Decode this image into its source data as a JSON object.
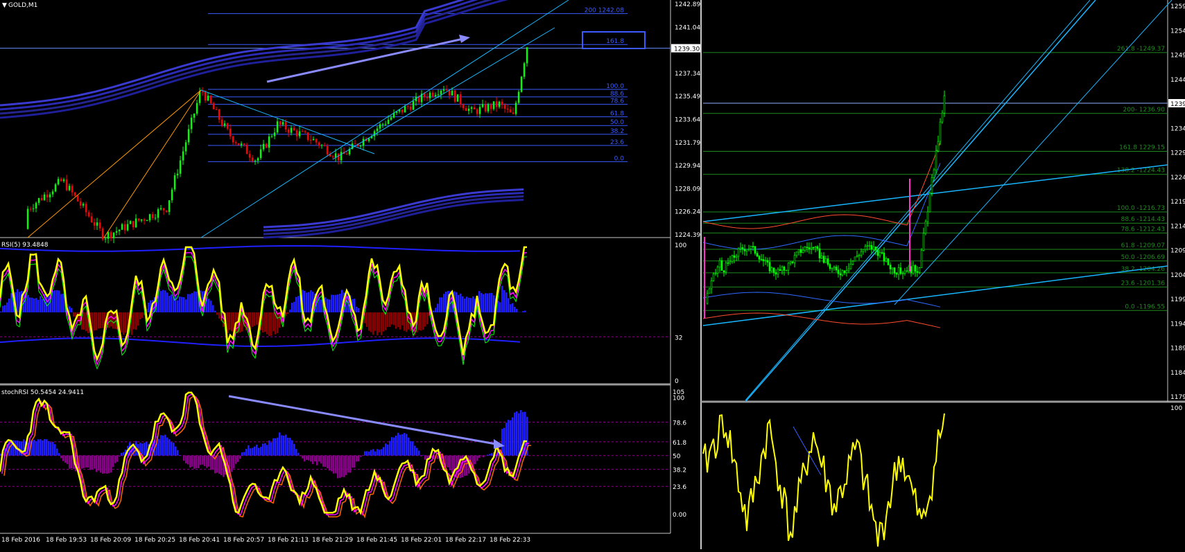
{
  "colors": {
    "background": "#000000",
    "bull_candle": "#00ff00",
    "bear_candle": "#ff0000",
    "fib_blue": "#3b5bff",
    "fib_green": "#1f8a1f",
    "rsi_yellow": "#ffff00",
    "hist_blue": "#1f1fff",
    "hist_red": "#8b0000",
    "hist_purple": "#8b008b",
    "trend_cyan": "#17b6ff",
    "arrow_violet": "#8a8aff",
    "divider": "#808080"
  },
  "left": {
    "main": {
      "title": "GOLD,M1",
      "price_current": "1239.30",
      "price_ticks": [
        "1242.89",
        "1241.04",
        "1237.34",
        "1235.49",
        "1233.64",
        "1231.79",
        "1229.94",
        "1228.09",
        "1226.24",
        "1224.39"
      ],
      "fib_labels": [
        "200 1242.08",
        "161.8",
        "100.0",
        "88.6",
        "78.6",
        "61.8",
        "50.0",
        "38.2",
        "23.6",
        "0.0"
      ]
    },
    "rsi": {
      "title": "RSI(5) 93.4848",
      "ticks": [
        "100",
        "32",
        "0"
      ]
    },
    "stoch": {
      "title": "stochRSI 50.5454 24.9411",
      "ticks": [
        "105",
        "100",
        "78.6",
        "61.8",
        "50",
        "38.2",
        "23.6",
        "0.00"
      ]
    },
    "time_labels": [
      "18 Feb 2016",
      "18 Feb 19:53",
      "18 Feb 20:09",
      "18 Feb 20:25",
      "18 Feb 20:41",
      "18 Feb 20:57",
      "18 Feb 21:13",
      "18 Feb 21:29",
      "18 Feb 21:45",
      "18 Feb 22:01",
      "18 Feb 22:17",
      "18 Feb 22:33"
    ]
  },
  "right": {
    "price_ticks": [
      "1259",
      "1254",
      "1249",
      "1244",
      "1239",
      "1234",
      "1229",
      "1224",
      "1219",
      "1214",
      "1209",
      "1204",
      "1199",
      "1194",
      "1189",
      "1184",
      "1179"
    ],
    "fib_labels": [
      "261.8 -1249.37",
      "200- 1236.90",
      "161.8 1229.15",
      "138.2 -1224.43",
      "100.0 -1216.73",
      "88.6 -1214.43",
      "78.6 -1212.43",
      "61.8 -1209.07",
      "50.0 -1206.69",
      "38.2 -1204.26",
      "23.6 -1201.36",
      "0.0 -1196.55"
    ],
    "current_tick": "1239",
    "lower_tick": "100"
  },
  "chart_data": [
    {
      "type": "candlestick",
      "title": "GOLD,M1",
      "ylim": [
        1224.39,
        1242.89
      ],
      "yticks": [
        1242.89,
        1241.04,
        1239.3,
        1237.34,
        1235.49,
        1233.64,
        1231.79,
        1229.94,
        1228.09,
        1226.24,
        1224.39
      ],
      "current_price": 1239.3,
      "fib_levels": [
        {
          "label": "200",
          "value": 1242.08
        },
        {
          "label": "161.8",
          "value": 1239.6
        },
        {
          "label": "100.0",
          "value": 1236.0
        },
        {
          "label": "88.6",
          "value": 1235.4
        },
        {
          "label": "78.6",
          "value": 1234.8
        },
        {
          "label": "61.8",
          "value": 1233.8
        },
        {
          "label": "50.0",
          "value": 1233.1
        },
        {
          "label": "38.2",
          "value": 1232.4
        },
        {
          "label": "23.6",
          "value": 1231.5
        },
        {
          "label": "0.0",
          "value": 1230.2
        }
      ],
      "x": [
        "18 Feb 2016",
        "18 Feb 19:53",
        "18 Feb 20:09",
        "18 Feb 20:25",
        "18 Feb 20:41",
        "18 Feb 20:57",
        "18 Feb 21:13",
        "18 Feb 21:29",
        "18 Feb 21:45",
        "18 Feb 22:01",
        "18 Feb 22:17",
        "18 Feb 22:33"
      ],
      "close": [
        1224.0,
        1226.3,
        1224.5,
        1226.0,
        1235.8,
        1231.0,
        1233.0,
        1230.5,
        1232.6,
        1236.2,
        1234.8,
        1239.3
      ]
    },
    {
      "type": "line",
      "title": "RSI(5) 93.4848",
      "ylim": [
        0,
        100
      ],
      "yticks": [
        100,
        32,
        0
      ],
      "series": [
        {
          "name": "RSI(5)",
          "values": [
            62,
            80,
            28,
            60,
            90,
            35,
            72,
            42,
            76,
            48,
            38,
            93.4848
          ]
        }
      ]
    },
    {
      "type": "line",
      "title": "stochRSI 50.5454 24.9411",
      "ylim": [
        0,
        105
      ],
      "yticks": [
        105,
        100,
        78.6,
        61.8,
        50,
        38.2,
        23.6,
        0
      ],
      "series": [
        {
          "name": "stochRSI",
          "values": [
            40,
            95,
            5,
            60,
            95,
            10,
            30,
            3,
            25,
            45,
            38,
            50.5454
          ]
        },
        {
          "name": "signal",
          "values": [
            35,
            90,
            8,
            55,
            88,
            12,
            25,
            5,
            20,
            42,
            35,
            24.9411
          ]
        }
      ]
    },
    {
      "type": "candlestick",
      "ylim": [
        1179,
        1259
      ],
      "yticks": [
        1259,
        1254,
        1249,
        1244,
        1239,
        1234,
        1229,
        1224,
        1219,
        1214,
        1209,
        1204,
        1199,
        1194,
        1189,
        1184,
        1179
      ],
      "current_price": 1239,
      "fib_levels": [
        {
          "label": "261.8",
          "value": 1249.37
        },
        {
          "label": "200",
          "value": 1236.9
        },
        {
          "label": "161.8",
          "value": 1229.15
        },
        {
          "label": "138.2",
          "value": 1224.43
        },
        {
          "label": "100.0",
          "value": 1216.73
        },
        {
          "label": "88.6",
          "value": 1214.43
        },
        {
          "label": "78.6",
          "value": 1212.43
        },
        {
          "label": "61.8",
          "value": 1209.07
        },
        {
          "label": "50.0",
          "value": 1206.69
        },
        {
          "label": "38.2",
          "value": 1204.26
        },
        {
          "label": "23.6",
          "value": 1201.36
        },
        {
          "label": "0.0",
          "value": 1196.55
        }
      ],
      "close": [
        1198,
        1205,
        1210,
        1203,
        1212,
        1206,
        1208,
        1204,
        1210,
        1238
      ]
    },
    {
      "type": "line",
      "yticks": [
        100
      ],
      "series": [
        {
          "name": "oscillator",
          "values": [
            60,
            95,
            20,
            90,
            10,
            85,
            30,
            75,
            5,
            70,
            15,
            100
          ]
        }
      ]
    }
  ]
}
